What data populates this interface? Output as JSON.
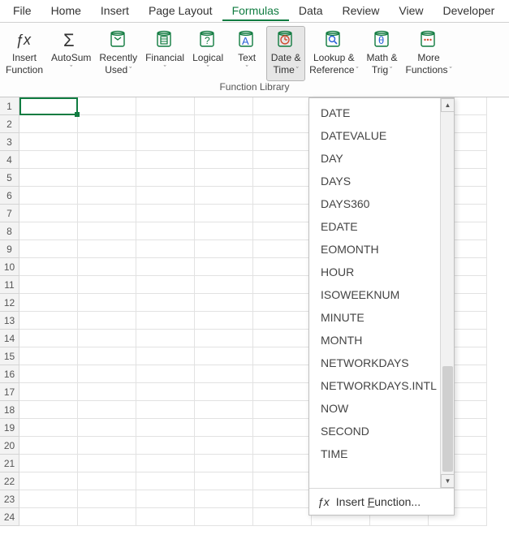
{
  "tabs": [
    "File",
    "Home",
    "Insert",
    "Page Layout",
    "Formulas",
    "Data",
    "Review",
    "View",
    "Developer"
  ],
  "active_tab_index": 4,
  "ribbon": {
    "group_label": "Function Library",
    "buttons": [
      {
        "key": "insert-function",
        "line1": "Insert",
        "line2": "Function",
        "caret": false
      },
      {
        "key": "autosum",
        "line1": "AutoSum",
        "line2": "",
        "caret": true
      },
      {
        "key": "recently-used",
        "line1": "Recently",
        "line2": "Used",
        "caret": true
      },
      {
        "key": "financial",
        "line1": "Financial",
        "line2": "",
        "caret": true
      },
      {
        "key": "logical",
        "line1": "Logical",
        "line2": "",
        "caret": true
      },
      {
        "key": "text",
        "line1": "Text",
        "line2": "",
        "caret": true
      },
      {
        "key": "date-time",
        "line1": "Date &",
        "line2": "Time",
        "caret": true,
        "highlight": true
      },
      {
        "key": "lookup-reference",
        "line1": "Lookup &",
        "line2": "Reference",
        "caret": true
      },
      {
        "key": "math-trig",
        "line1": "Math &",
        "line2": "Trig",
        "caret": true
      },
      {
        "key": "more-functions",
        "line1": "More",
        "line2": "Functions",
        "caret": true
      }
    ]
  },
  "menu": {
    "items": [
      "DATE",
      "DATEVALUE",
      "DAY",
      "DAYS",
      "DAYS360",
      "EDATE",
      "EOMONTH",
      "HOUR",
      "ISOWEEKNUM",
      "MINUTE",
      "MONTH",
      "NETWORKDAYS",
      "NETWORKDAYS.INTL",
      "NOW",
      "SECOND",
      "TIME"
    ],
    "footer_prefix": "Insert ",
    "footer_letter": "F",
    "footer_suffix": "unction..."
  },
  "row_headers": [
    "1",
    "2",
    "3",
    "4",
    "5",
    "6",
    "7",
    "8",
    "9",
    "10",
    "11",
    "12",
    "13",
    "14",
    "15",
    "16",
    "17",
    "18",
    "19",
    "20",
    "21",
    "22",
    "23",
    "24"
  ],
  "cols_visible": 8,
  "caret_glyph": "ˇ"
}
